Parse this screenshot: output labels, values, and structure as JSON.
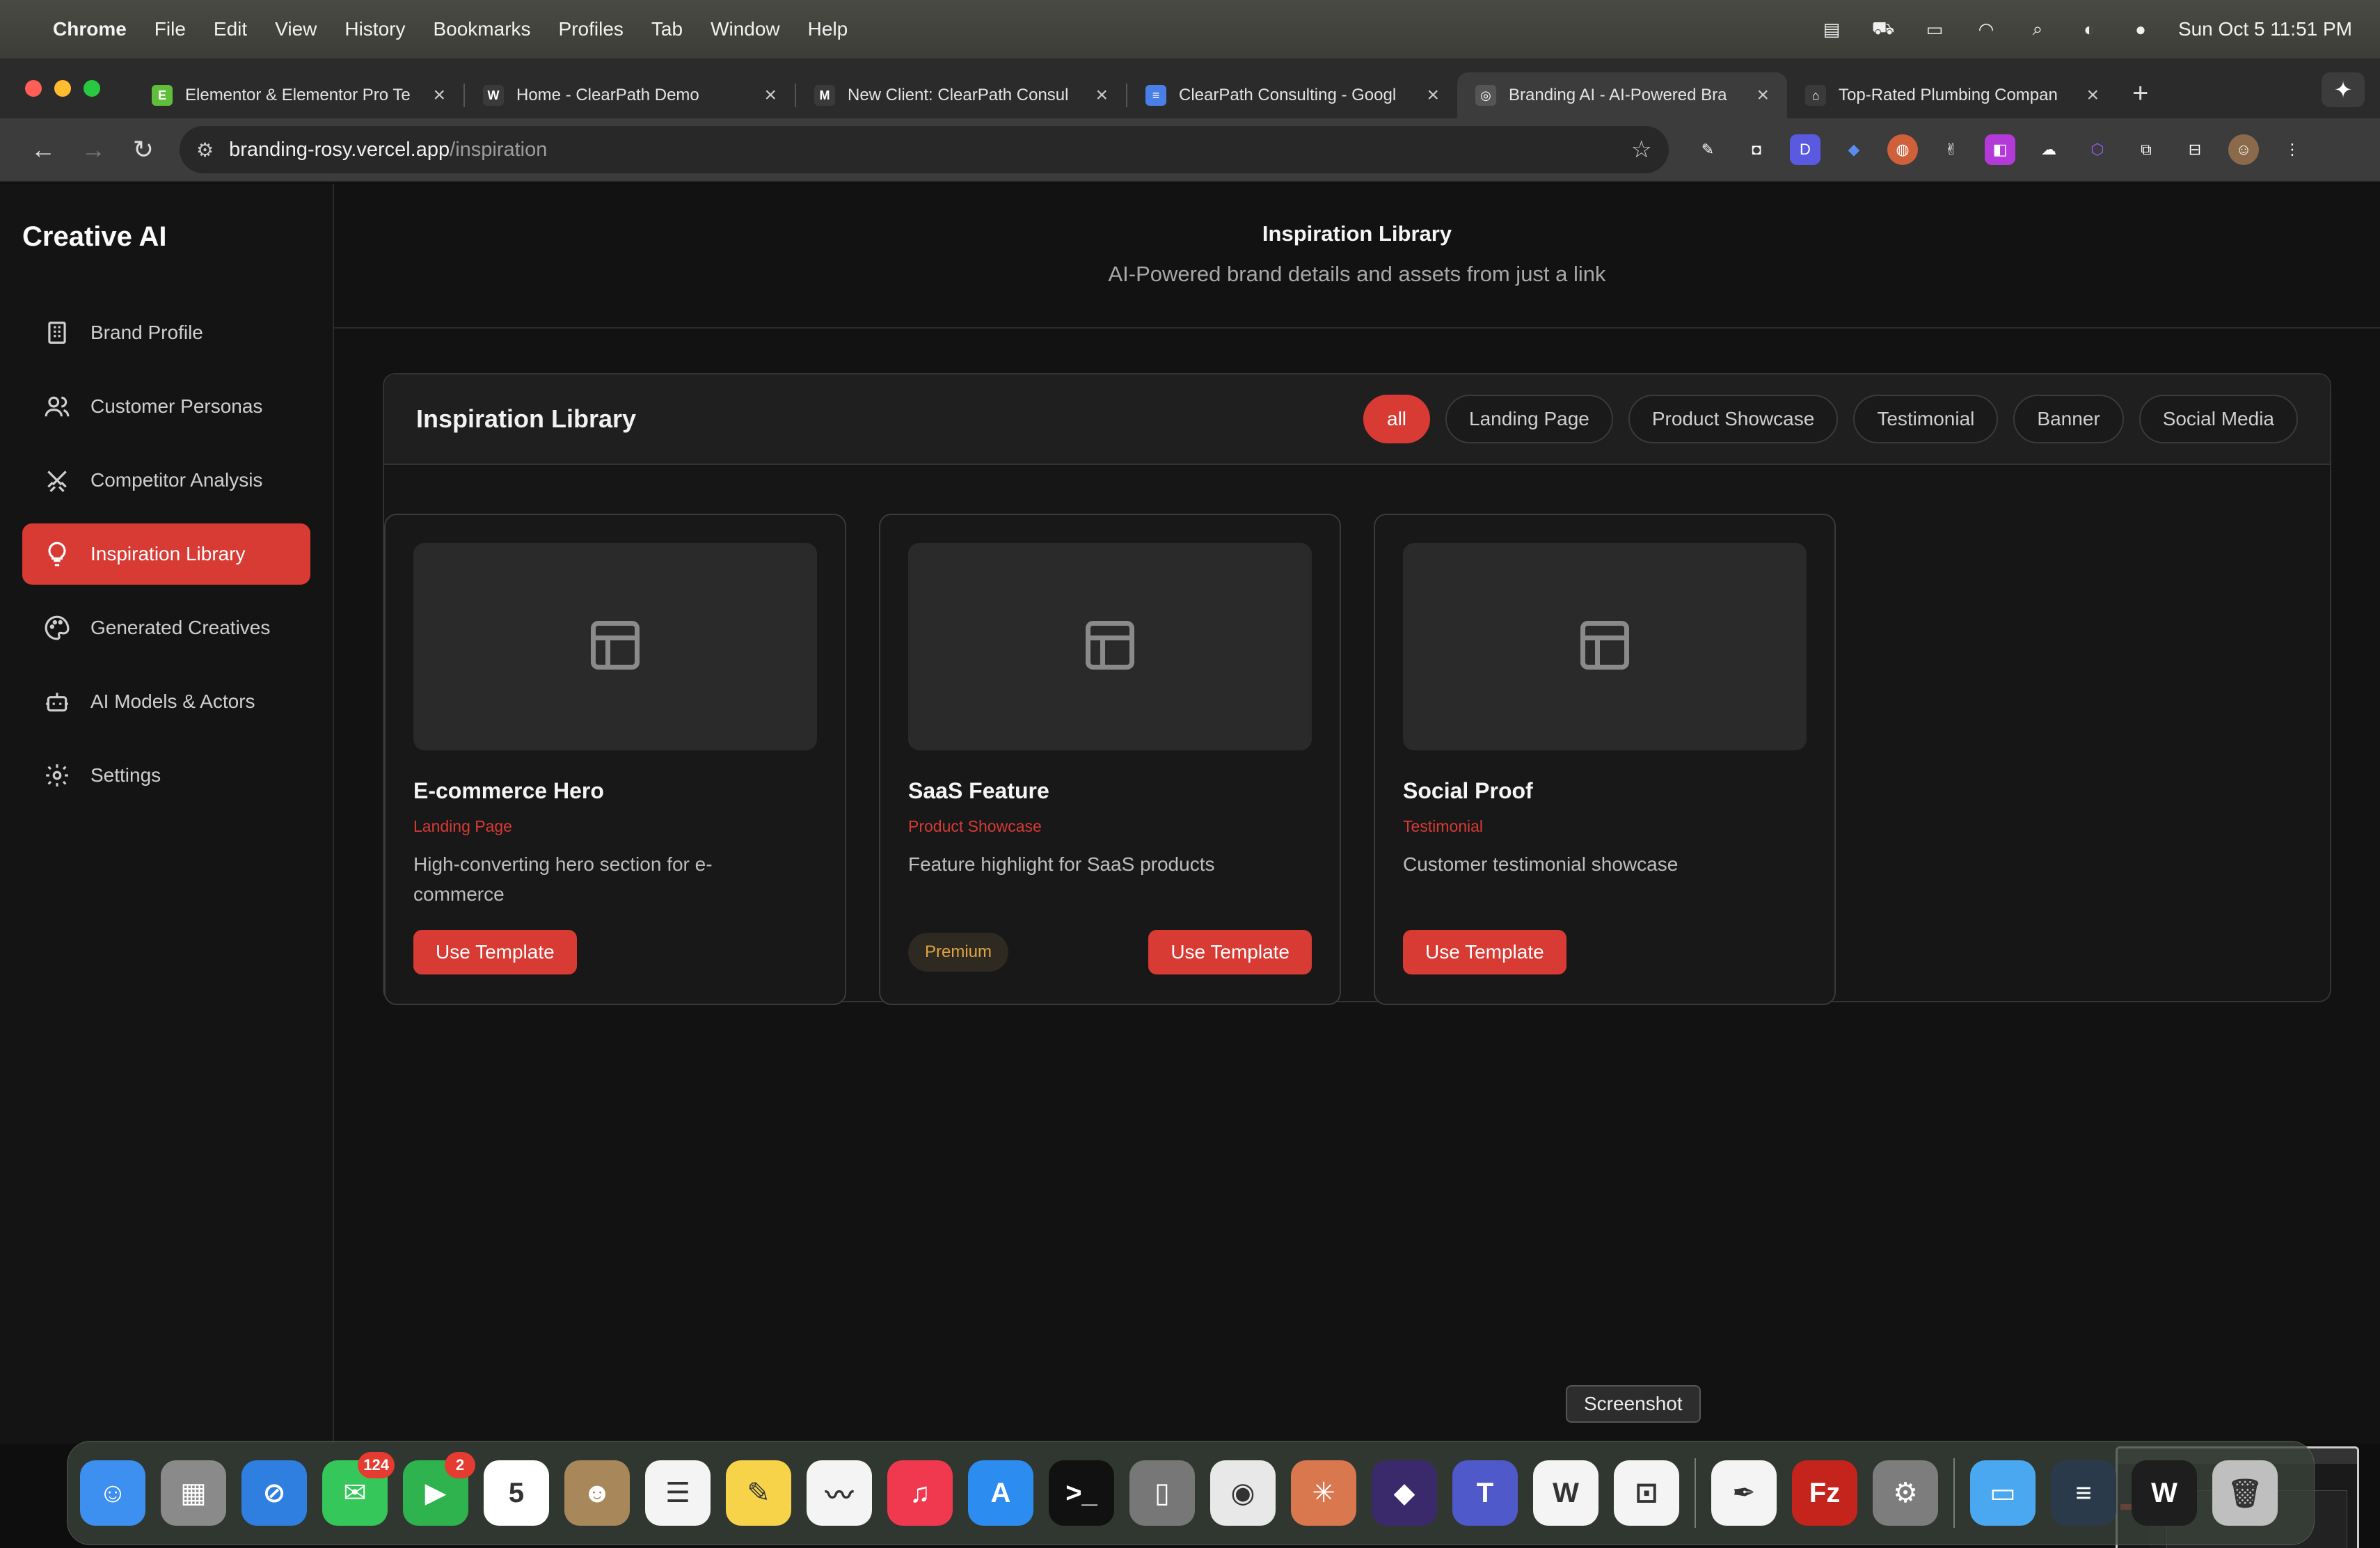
{
  "menubar": {
    "apple_icon": "apple-logo-icon",
    "items": [
      "Chrome",
      "File",
      "Edit",
      "View",
      "History",
      "Bookmarks",
      "Profiles",
      "Tab",
      "Window",
      "Help"
    ],
    "datetime": "Sun Oct 5  11:51 PM"
  },
  "tabs": [
    {
      "title": "Elementor & Elementor Pro Te",
      "favicon_color": "#5fbf3a",
      "favicon_glyph": "E",
      "active": false
    },
    {
      "title": "Home - ClearPath Demo",
      "favicon_color": "#3a3a3a",
      "favicon_glyph": "W",
      "active": false
    },
    {
      "title": "New Client: ClearPath Consul",
      "favicon_color": "#3a3a3a",
      "favicon_glyph": "M",
      "active": false
    },
    {
      "title": "ClearPath Consulting - Googl",
      "favicon_color": "#4a7fe8",
      "favicon_glyph": "≡",
      "active": false
    },
    {
      "title": "Branding AI - AI-Powered Bra",
      "favicon_color": "#555555",
      "favicon_glyph": "◎",
      "active": true
    },
    {
      "title": "Top-Rated Plumbing Compan",
      "favicon_color": "#3a3a3a",
      "favicon_glyph": "⌂",
      "active": false
    }
  ],
  "omnibox": {
    "host": "branding-rosy.vercel.app",
    "path": "/inspiration"
  },
  "sidebar": {
    "brand": "Creative AI",
    "items": [
      {
        "label": "Brand Profile",
        "icon": "building-icon",
        "active": false
      },
      {
        "label": "Customer Personas",
        "icon": "users-icon",
        "active": false
      },
      {
        "label": "Competitor Analysis",
        "icon": "swords-icon",
        "active": false
      },
      {
        "label": "Inspiration Library",
        "icon": "lightbulb-icon",
        "active": true
      },
      {
        "label": "Generated Creatives",
        "icon": "palette-icon",
        "active": false
      },
      {
        "label": "AI Models & Actors",
        "icon": "bot-icon",
        "active": false
      },
      {
        "label": "Settings",
        "icon": "gear-icon",
        "active": false
      }
    ]
  },
  "header": {
    "title": "Inspiration Library",
    "subtitle": "AI-Powered brand details and assets from just a link"
  },
  "library": {
    "title": "Inspiration Library",
    "filters": [
      {
        "label": "all",
        "active": true
      },
      {
        "label": "Landing Page",
        "active": false
      },
      {
        "label": "Product Showcase",
        "active": false
      },
      {
        "label": "Testimonial",
        "active": false
      },
      {
        "label": "Banner",
        "active": false
      },
      {
        "label": "Social Media",
        "active": false
      }
    ],
    "cards": [
      {
        "title": "E-commerce Hero",
        "category": "Landing Page",
        "description": "High-converting hero section for e-commerce",
        "button": "Use Template",
        "badge": ""
      },
      {
        "title": "SaaS Feature",
        "category": "Product Showcase",
        "description": "Feature highlight for SaaS products",
        "button": "Use Template",
        "badge": "Premium"
      },
      {
        "title": "Social Proof",
        "category": "Testimonial",
        "description": "Customer testimonial showcase",
        "button": "Use Template",
        "badge": ""
      }
    ]
  },
  "tooltip": "Screenshot",
  "dock": {
    "apps": [
      {
        "name": "finder-icon",
        "color": "#3d8ff0",
        "glyph": "☺",
        "badge": ""
      },
      {
        "name": "launchpad-icon",
        "color": "#8a8a8a",
        "glyph": "▦",
        "badge": ""
      },
      {
        "name": "safari-icon",
        "color": "#2f7fe0",
        "glyph": "⊘",
        "badge": ""
      },
      {
        "name": "messages-icon",
        "color": "#35c759",
        "glyph": "✉",
        "badge": "124"
      },
      {
        "name": "facetime-icon",
        "color": "#2fb34e",
        "glyph": "▶",
        "badge": "2"
      },
      {
        "name": "calendar-icon",
        "color": "#ffffff",
        "glyph": "5",
        "badge": ""
      },
      {
        "name": "contacts-icon",
        "color": "#a8875a",
        "glyph": "☻",
        "badge": ""
      },
      {
        "name": "reminders-icon",
        "color": "#f4f4f4",
        "glyph": "☰",
        "badge": ""
      },
      {
        "name": "notes-icon",
        "color": "#f7d34a",
        "glyph": "✎",
        "badge": ""
      },
      {
        "name": "freeform-icon",
        "color": "#f4f4f4",
        "glyph": "〰",
        "badge": ""
      },
      {
        "name": "music-icon",
        "color": "#f0394f",
        "glyph": "♫",
        "badge": ""
      },
      {
        "name": "app-store-icon",
        "color": "#2d8cf0",
        "glyph": "A",
        "badge": ""
      },
      {
        "name": "terminal-icon",
        "color": "#111111",
        "glyph": ">_",
        "badge": ""
      },
      {
        "name": "iphone-mirroring-icon",
        "color": "#777777",
        "glyph": "▯",
        "badge": ""
      },
      {
        "name": "chrome-icon",
        "color": "#e8e8e8",
        "glyph": "◉",
        "badge": ""
      },
      {
        "name": "claude-icon",
        "color": "#d9774e",
        "glyph": "✳",
        "badge": ""
      },
      {
        "name": "obsidian-icon",
        "color": "#3b2a6b",
        "glyph": "◆",
        "badge": ""
      },
      {
        "name": "teams-icon",
        "color": "#5059c9",
        "glyph": "T",
        "badge": ""
      },
      {
        "name": "wispr-icon",
        "color": "#f4f4f4",
        "glyph": "W",
        "badge": ""
      },
      {
        "name": "screenshot-icon",
        "color": "#f4f4f4",
        "glyph": "⊡",
        "badge": ""
      },
      {
        "name": "textedit-icon",
        "color": "#f4f4f4",
        "glyph": "✒",
        "badge": ""
      },
      {
        "name": "filezilla-icon",
        "color": "#c4241c",
        "glyph": "Fz",
        "badge": ""
      },
      {
        "name": "system-settings-icon",
        "color": "#7d7d7d",
        "glyph": "⚙",
        "badge": ""
      },
      {
        "name": "folder-icon",
        "color": "#4aa8f0",
        "glyph": "▭",
        "badge": ""
      },
      {
        "name": "recent-doc-icon",
        "color": "#2a3a4a",
        "glyph": "≡",
        "badge": ""
      },
      {
        "name": "recent-window-icon",
        "color": "#1e1e1e",
        "glyph": "W",
        "badge": ""
      },
      {
        "name": "trash-icon",
        "color": "#bfbfbf",
        "glyph": "🗑",
        "badge": ""
      }
    ]
  }
}
